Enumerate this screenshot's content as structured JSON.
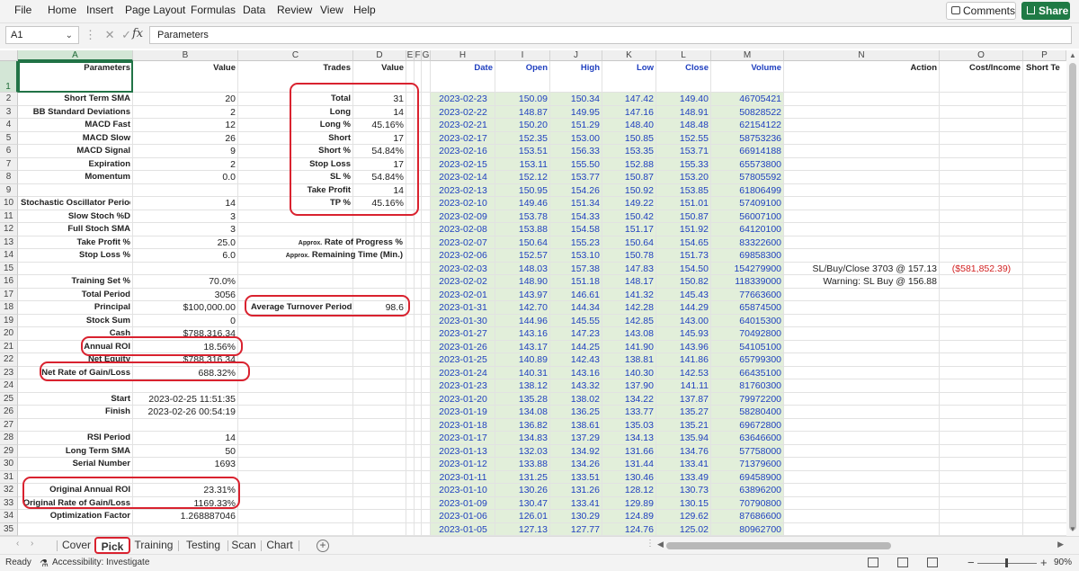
{
  "menu": [
    "File",
    "Home",
    "Insert",
    "Page Layout",
    "Formulas",
    "Data",
    "Review",
    "View",
    "Help"
  ],
  "toolbar": {
    "comments": "Comments",
    "share": "Share"
  },
  "formula_bar": {
    "name_box": "A1",
    "fx": "fx",
    "content": "Parameters"
  },
  "columns": [
    "A",
    "B",
    "C",
    "D",
    "E",
    "F",
    "G",
    "H",
    "I",
    "J",
    "K",
    "L",
    "M",
    "N",
    "O",
    "P"
  ],
  "rows": [
    "1",
    "2",
    "3",
    "4",
    "5",
    "6",
    "7",
    "8",
    "9",
    "10",
    "11",
    "12",
    "13",
    "14",
    "15",
    "16",
    "17",
    "18",
    "19",
    "20",
    "21",
    "22",
    "23",
    "24",
    "25",
    "26",
    "27",
    "28",
    "29",
    "30",
    "31",
    "32",
    "33",
    "34",
    "35"
  ],
  "headers": {
    "A": "Parameters",
    "B": "Value",
    "C": "Trades",
    "D": "Value",
    "H": "Date",
    "I": "Open",
    "J": "High",
    "K": "Low",
    "L": "Close",
    "M": "Volume",
    "N": "Action",
    "O": "Cost/Income",
    "P": "Short Te"
  },
  "params": [
    {
      "row": 2,
      "label": "Short Term SMA",
      "value": "20"
    },
    {
      "row": 3,
      "label": "BB Standard Deviations",
      "value": "2"
    },
    {
      "row": 4,
      "label": "MACD Fast",
      "value": "12"
    },
    {
      "row": 5,
      "label": "MACD Slow",
      "value": "26"
    },
    {
      "row": 6,
      "label": "MACD Signal",
      "value": "9"
    },
    {
      "row": 7,
      "label": "Expiration",
      "value": "2"
    },
    {
      "row": 8,
      "label": "Momentum",
      "value": "0.0"
    },
    {
      "row": 10,
      "label": "Stochastic Oscillator Period",
      "value": "14"
    },
    {
      "row": 11,
      "label": "Slow Stoch %D",
      "value": "3"
    },
    {
      "row": 12,
      "label": "Full Stoch SMA",
      "value": "3"
    },
    {
      "row": 13,
      "label": "Take Profit %",
      "value": "25.0"
    },
    {
      "row": 14,
      "label": "Stop Loss %",
      "value": "6.0"
    },
    {
      "row": 16,
      "label": "Training Set %",
      "value": "70.0%"
    },
    {
      "row": 17,
      "label": "Total Period",
      "value": "3056"
    },
    {
      "row": 18,
      "label": "Principal",
      "value": "$100,000.00"
    },
    {
      "row": 19,
      "label": "Stock Sum",
      "value": "0"
    },
    {
      "row": 20,
      "label": "Cash",
      "value": "$788,316.34"
    },
    {
      "row": 21,
      "label": "Annual ROI",
      "value": "18.56%"
    },
    {
      "row": 22,
      "label": "Net Equity",
      "value": "$788,316.34"
    },
    {
      "row": 23,
      "label": "Net Rate of Gain/Loss",
      "value": "688.32%"
    },
    {
      "row": 25,
      "label": "Start",
      "value": "2023-02-25 11:51:35"
    },
    {
      "row": 26,
      "label": "Finish",
      "value": "2023-02-26 00:54:19"
    },
    {
      "row": 28,
      "label": "RSI Period",
      "value": "14"
    },
    {
      "row": 29,
      "label": "Long Term SMA",
      "value": "50"
    },
    {
      "row": 30,
      "label": "Serial Number",
      "value": "1693"
    },
    {
      "row": 32,
      "label": "Original Annual ROI",
      "value": "23.31%"
    },
    {
      "row": 33,
      "label": "Original Rate of Gain/Loss",
      "value": "1169.33%"
    },
    {
      "row": 34,
      "label": "Optimization Factor",
      "value": "1.268887046"
    }
  ],
  "trades": [
    {
      "row": 2,
      "label": "Total",
      "value": "31"
    },
    {
      "row": 3,
      "label": "Long",
      "value": "14"
    },
    {
      "row": 4,
      "label": "Long %",
      "value": "45.16%"
    },
    {
      "row": 5,
      "label": "Short",
      "value": "17"
    },
    {
      "row": 6,
      "label": "Short %",
      "value": "54.84%"
    },
    {
      "row": 7,
      "label": "Stop Loss",
      "value": "17"
    },
    {
      "row": 8,
      "label": "SL %",
      "value": "54.84%"
    },
    {
      "row": 9,
      "label": "Take Profit",
      "value": "14"
    },
    {
      "row": 10,
      "label": "TP %",
      "value": "45.16%"
    }
  ],
  "approx": [
    {
      "row": 13,
      "small": "Approx.",
      "label": "Rate of Progress %"
    },
    {
      "row": 14,
      "small": "Approx.",
      "label": "Remaining Time (Min.)"
    }
  ],
  "turnover": {
    "row": 18,
    "label": "Average Turnover Period",
    "value": "98.6"
  },
  "prices": [
    [
      "2023-02-23",
      "150.09",
      "150.34",
      "147.42",
      "149.40",
      "46705421"
    ],
    [
      "2023-02-22",
      "148.87",
      "149.95",
      "147.16",
      "148.91",
      "50828522"
    ],
    [
      "2023-02-21",
      "150.20",
      "151.29",
      "148.40",
      "148.48",
      "62154122"
    ],
    [
      "2023-02-17",
      "152.35",
      "153.00",
      "150.85",
      "152.55",
      "58753236"
    ],
    [
      "2023-02-16",
      "153.51",
      "156.33",
      "153.35",
      "153.71",
      "66914188"
    ],
    [
      "2023-02-15",
      "153.11",
      "155.50",
      "152.88",
      "155.33",
      "65573800"
    ],
    [
      "2023-02-14",
      "152.12",
      "153.77",
      "150.87",
      "153.20",
      "57805592"
    ],
    [
      "2023-02-13",
      "150.95",
      "154.26",
      "150.92",
      "153.85",
      "61806499"
    ],
    [
      "2023-02-10",
      "149.46",
      "151.34",
      "149.22",
      "151.01",
      "57409100"
    ],
    [
      "2023-02-09",
      "153.78",
      "154.33",
      "150.42",
      "150.87",
      "56007100"
    ],
    [
      "2023-02-08",
      "153.88",
      "154.58",
      "151.17",
      "151.92",
      "64120100"
    ],
    [
      "2023-02-07",
      "150.64",
      "155.23",
      "150.64",
      "154.65",
      "83322600"
    ],
    [
      "2023-02-06",
      "152.57",
      "153.10",
      "150.78",
      "151.73",
      "69858300"
    ],
    [
      "2023-02-03",
      "148.03",
      "157.38",
      "147.83",
      "154.50",
      "154279900"
    ],
    [
      "2023-02-02",
      "148.90",
      "151.18",
      "148.17",
      "150.82",
      "118339000"
    ],
    [
      "2023-02-01",
      "143.97",
      "146.61",
      "141.32",
      "145.43",
      "77663600"
    ],
    [
      "2023-01-31",
      "142.70",
      "144.34",
      "142.28",
      "144.29",
      "65874500"
    ],
    [
      "2023-01-30",
      "144.96",
      "145.55",
      "142.85",
      "143.00",
      "64015300"
    ],
    [
      "2023-01-27",
      "143.16",
      "147.23",
      "143.08",
      "145.93",
      "70492800"
    ],
    [
      "2023-01-26",
      "143.17",
      "144.25",
      "141.90",
      "143.96",
      "54105100"
    ],
    [
      "2023-01-25",
      "140.89",
      "142.43",
      "138.81",
      "141.86",
      "65799300"
    ],
    [
      "2023-01-24",
      "140.31",
      "143.16",
      "140.30",
      "142.53",
      "66435100"
    ],
    [
      "2023-01-23",
      "138.12",
      "143.32",
      "137.90",
      "141.11",
      "81760300"
    ],
    [
      "2023-01-20",
      "135.28",
      "138.02",
      "134.22",
      "137.87",
      "79972200"
    ],
    [
      "2023-01-19",
      "134.08",
      "136.25",
      "133.77",
      "135.27",
      "58280400"
    ],
    [
      "2023-01-18",
      "136.82",
      "138.61",
      "135.03",
      "135.21",
      "69672800"
    ],
    [
      "2023-01-17",
      "134.83",
      "137.29",
      "134.13",
      "135.94",
      "63646600"
    ],
    [
      "2023-01-13",
      "132.03",
      "134.92",
      "131.66",
      "134.76",
      "57758000"
    ],
    [
      "2023-01-12",
      "133.88",
      "134.26",
      "131.44",
      "133.41",
      "71379600"
    ],
    [
      "2023-01-11",
      "131.25",
      "133.51",
      "130.46",
      "133.49",
      "69458900"
    ],
    [
      "2023-01-10",
      "130.26",
      "131.26",
      "128.12",
      "130.73",
      "63896200"
    ],
    [
      "2023-01-09",
      "130.47",
      "133.41",
      "129.89",
      "130.15",
      "70790800"
    ],
    [
      "2023-01-06",
      "126.01",
      "130.29",
      "124.89",
      "129.62",
      "87686600"
    ],
    [
      "2023-01-05",
      "127.13",
      "127.77",
      "124.76",
      "125.02",
      "80962700"
    ]
  ],
  "actions": [
    {
      "row": 15,
      "action": "SL/Buy/Close 3703 @ 157.13",
      "cost": "($581,852.39)"
    },
    {
      "row": 16,
      "action": "Warning: SL Buy @ 156.88",
      "cost": ""
    }
  ],
  "sheets": [
    "Cover",
    "Pick",
    "Training",
    "Testing",
    "Scan",
    "Chart"
  ],
  "active_sheet": "Pick",
  "status": {
    "ready": "Ready",
    "accessibility": "Accessibility: Investigate",
    "zoom": "90%"
  },
  "colors": {
    "accent": "#217346",
    "share": "#1f7a45",
    "blue_text": "#1f3fbf",
    "negative": "#d22222",
    "green_band": "#e2efda",
    "highlight_oval": "#d9222f"
  }
}
